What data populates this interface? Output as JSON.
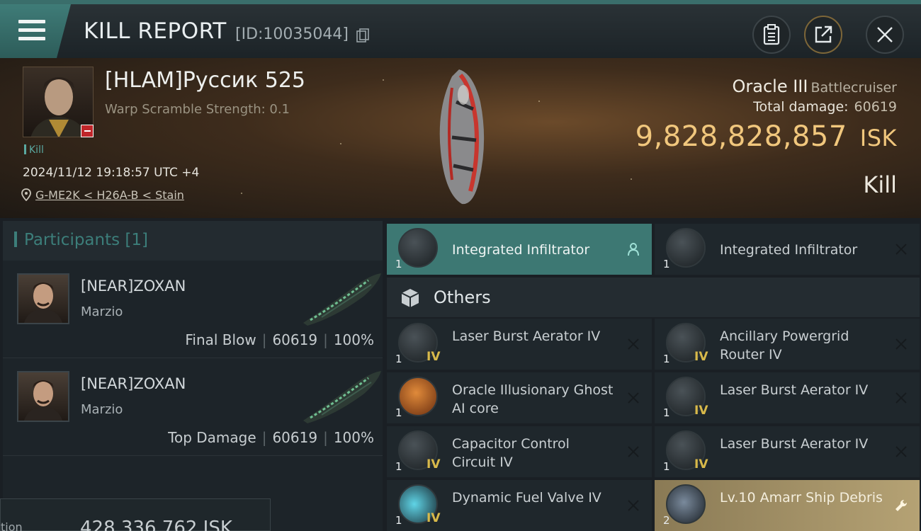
{
  "header": {
    "title": "KILL REPORT",
    "report_id": "[ID:10035044]"
  },
  "victim": {
    "pilot": "[HLAM]Руссик 525",
    "warp_scramble": "Warp Scramble Strength: 0.1",
    "tag": "Kill",
    "timestamp": "2024/11/12 19:18:57 UTC +4",
    "location": "G-ME2K < H26A-B < Stain",
    "ship": "Oracle III",
    "ship_class": "Battlecruiser",
    "total_damage_label": "Total damage:",
    "total_damage": "60619",
    "isk_value": "9,828,828,857",
    "isk_unit": "ISK",
    "result": "Kill"
  },
  "participants": {
    "title": "Participants [1]",
    "rows": [
      {
        "name": "[NEAR]ZOXAN",
        "ship": "Marzio",
        "role": "Final Blow",
        "damage": "60619",
        "percent": "100%"
      },
      {
        "name": "[NEAR]ZOXAN",
        "ship": "Marzio",
        "role": "Top Damage",
        "damage": "60619",
        "percent": "100%"
      }
    ],
    "bottom_label": "tion",
    "bottom_value": "428,336,762 ISK"
  },
  "items": {
    "fitted": [
      {
        "qty": "1",
        "name": "Integrated Infiltrator",
        "action": "person-icon"
      },
      {
        "qty": "1",
        "name": "Integrated Infiltrator",
        "action": "close-icon"
      }
    ],
    "others_label": "Others",
    "others": [
      {
        "qty": "1",
        "level": "IV",
        "name": "Laser Burst Aerator IV"
      },
      {
        "qty": "1",
        "level": "IV",
        "name": "Ancillary Powergrid Router IV"
      },
      {
        "qty": "1",
        "level": "",
        "name": "Oracle Illusionary Ghost AI core"
      },
      {
        "qty": "1",
        "level": "IV",
        "name": "Laser Burst Aerator IV"
      },
      {
        "qty": "1",
        "level": "IV",
        "name": "Capacitor Control Circuit IV"
      },
      {
        "qty": "1",
        "level": "IV",
        "name": "Laser Burst Aerator IV"
      },
      {
        "qty": "1",
        "level": "IV",
        "name": "Dynamic Fuel Valve IV"
      },
      {
        "qty": "2",
        "level": "",
        "name": "Lv.10 Amarr Ship Debris"
      }
    ]
  },
  "colors": {
    "accent_teal": "#3d7873",
    "isk_gold": "#f1c77d",
    "debris_gold": "#b5a274",
    "danger_red": "#c0262a"
  }
}
